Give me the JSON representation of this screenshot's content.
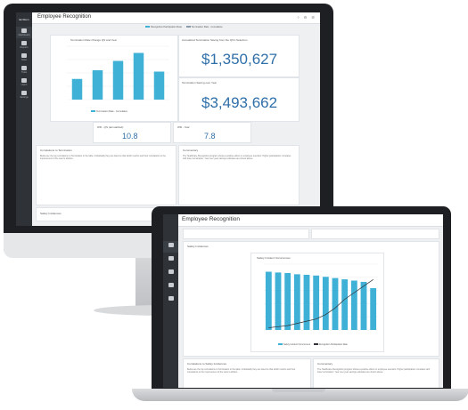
{
  "app": {
    "logo": "Emblem",
    "title": "Employee Recognition",
    "header_icons": "? ⚙ ☰"
  },
  "sidebar": {
    "items": [
      {
        "label": "Dashboard",
        "icon": "dashboard-icon"
      },
      {
        "label": "Reports",
        "icon": "reports-icon"
      },
      {
        "label": "Data",
        "icon": "data-icon"
      },
      {
        "label": "Tools",
        "icon": "tools-icon"
      },
      {
        "label": "Users",
        "icon": "users-icon"
      },
      {
        "label": "Settings",
        "icon": "settings-icon"
      }
    ]
  },
  "monitor": {
    "legend": [
      "Recognition Participation Rate",
      "Termination Rate - Cumulative"
    ],
    "cards": {
      "termination_chart": {
        "title": "Termination Rate Change QS and Year",
        "legend": "Termination Rate - Cumulative"
      },
      "annualized_savings": {
        "title": "Annualized Termination Saving from the QS's Selection",
        "value": "$1,350,627"
      },
      "savings_over_year": {
        "title": "Termination Saving over Year",
        "value": "$3,493,662"
      },
      "wr_annualized": {
        "title": "WR - QS (annualized)",
        "value": "10.8"
      },
      "wr_year": {
        "title": "WR - Year",
        "value": "7.8"
      },
      "correlations": {
        "title": "Correlations to Termination",
        "body": "Below are the top correlations to Termination in the table. Individually they are listed so that which metrics and their correlations to the improvement of the team's attrition."
      },
      "commentary": {
        "title": "Commentary",
        "body": "The Healthcare Recognition program shows a positive effect on employee retention. Higher participation correlates with lower termination. Year over year savings estimates are shown above."
      },
      "safety": {
        "title": "Safety Incidences"
      }
    }
  },
  "laptop": {
    "title": "Employee Recognition",
    "section": "Safety Incidences",
    "chart": {
      "title": "Safety Incident Occurrences"
    },
    "correlations_title": "Correlations to Safety Incidences",
    "commentary_title": "Commentary",
    "legend": [
      "Safety Incident Occurrences",
      "Recognition Participation Rate"
    ]
  },
  "chart_data": [
    {
      "type": "bar",
      "title": "Termination Rate Change QS and Year",
      "categories": [
        "",
        "",
        "",
        "",
        ""
      ],
      "values": [
        3.1,
        4.4,
        5.8,
        7.0,
        4.2
      ],
      "ylim": [
        0,
        8
      ],
      "grid": true
    },
    {
      "type": "bar",
      "title": "Safety Incident Occurrences",
      "categories": [
        "",
        "",
        "",
        "",
        "",
        "",
        "",
        "",
        "",
        "",
        "",
        ""
      ],
      "series": [
        {
          "values": [
            2300,
            2270,
            2250,
            2200,
            2180,
            2150,
            2100,
            2050,
            2000,
            1950,
            1900,
            1650
          ]
        },
        {
          "values": [
            2,
            3,
            4,
            6,
            8,
            10,
            14,
            20,
            28,
            34,
            40,
            46
          ]
        }
      ],
      "ylim": [
        0,
        2600
      ],
      "grid": true
    }
  ]
}
